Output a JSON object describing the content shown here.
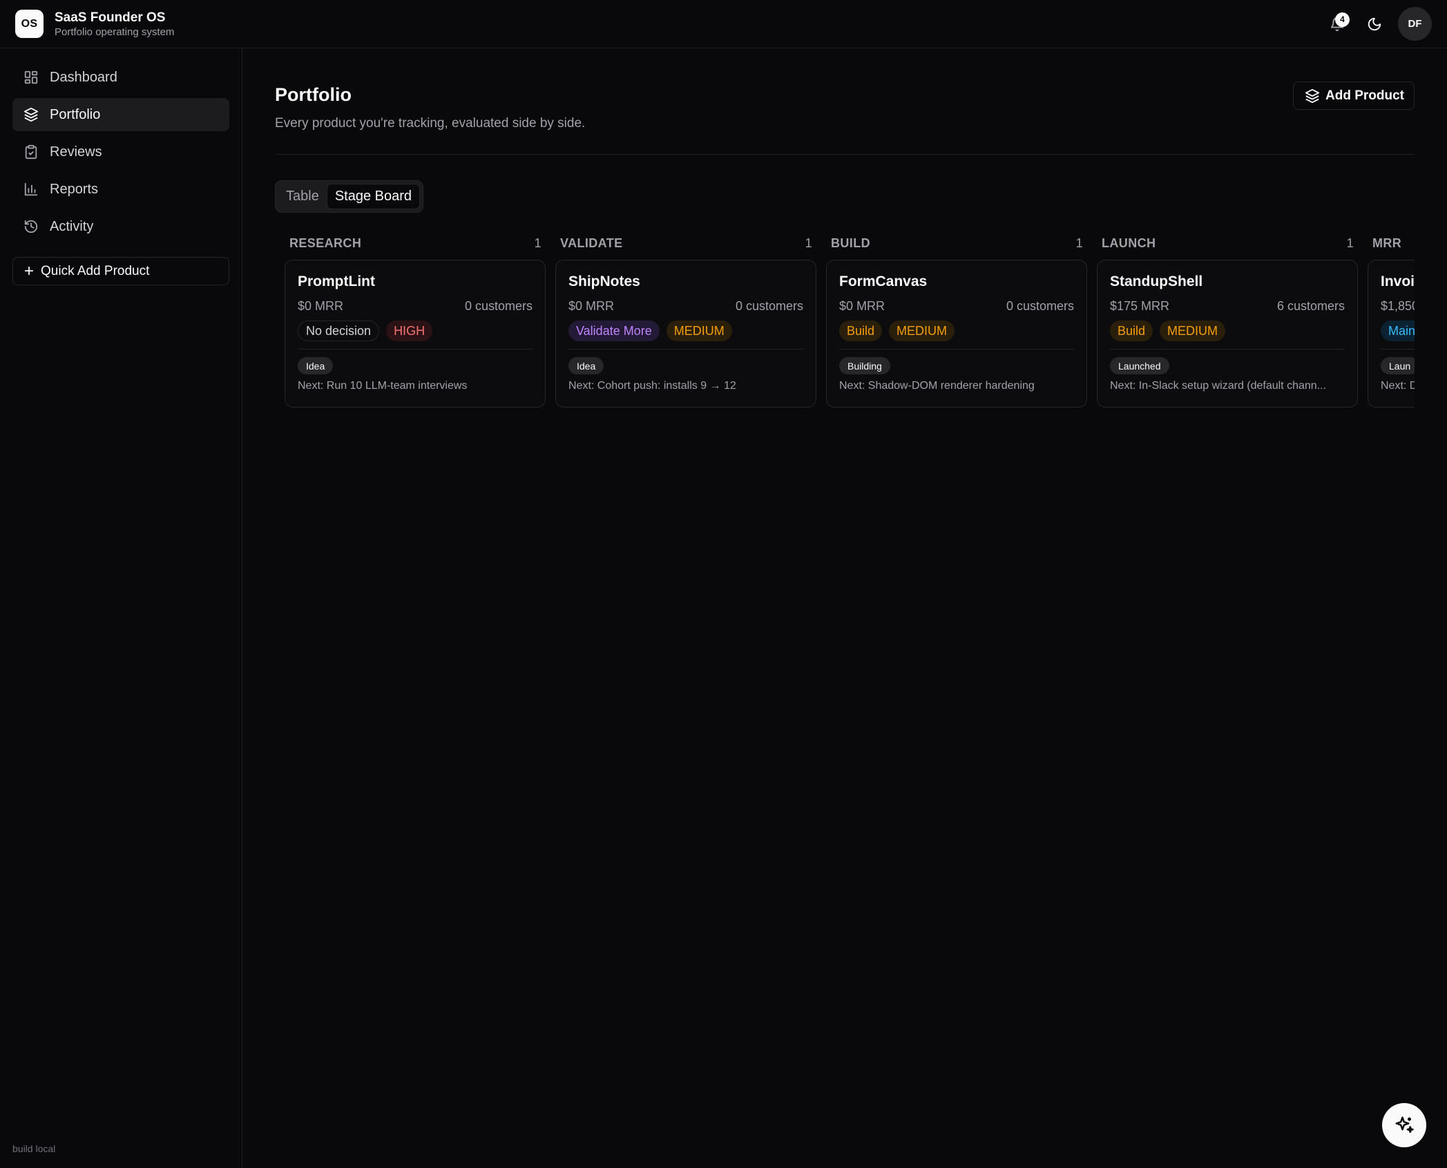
{
  "app": {
    "title": "SaaS Founder OS",
    "subtitle": "Portfolio operating system",
    "logo_text": "OS"
  },
  "header": {
    "notifications_count": "4",
    "avatar_initials": "DF",
    "icons": [
      "bell-icon",
      "moon-icon"
    ]
  },
  "sidebar": {
    "items": [
      {
        "label": "Dashboard",
        "icon": "dashboard-icon",
        "active": false
      },
      {
        "label": "Portfolio",
        "icon": "layers-icon",
        "active": true
      },
      {
        "label": "Reviews",
        "icon": "clipboard-check-icon",
        "active": false
      },
      {
        "label": "Reports",
        "icon": "bar-chart-icon",
        "active": false
      },
      {
        "label": "Activity",
        "icon": "history-icon",
        "active": false
      }
    ],
    "quick_add_label": "Quick Add Product",
    "build_label": "build local"
  },
  "page": {
    "title": "Portfolio",
    "subtitle": "Every product you're tracking, evaluated side by side.",
    "add_button_label": "Add Product",
    "view_toggle": {
      "options": [
        "Table",
        "Stage Board"
      ],
      "selected": "Stage Board"
    }
  },
  "board": {
    "columns": [
      {
        "name": "RESEARCH",
        "count": "1",
        "card": {
          "title": "PromptLint",
          "mrr": "$0 MRR",
          "customers": "0 customers",
          "decision": "No decision",
          "priority": "HIGH",
          "stage": "Idea",
          "next": "Next: Run 10 LLM-team interviews"
        }
      },
      {
        "name": "VALIDATE",
        "count": "1",
        "card": {
          "title": "ShipNotes",
          "mrr": "$0 MRR",
          "customers": "0 customers",
          "decision": "Validate More",
          "priority": "MEDIUM",
          "stage": "Idea",
          "next": "Next: Cohort push: installs 9 → 12"
        }
      },
      {
        "name": "BUILD",
        "count": "1",
        "card": {
          "title": "FormCanvas",
          "mrr": "$0 MRR",
          "customers": "0 customers",
          "decision": "Build",
          "priority": "MEDIUM",
          "stage": "Building",
          "next": "Next: Shadow-DOM renderer hardening"
        }
      },
      {
        "name": "LAUNCH",
        "count": "1",
        "card": {
          "title": "StandupShell",
          "mrr": "$175 MRR",
          "customers": "6 customers",
          "decision": "Build",
          "priority": "MEDIUM",
          "stage": "Launched",
          "next": "Next: In-Slack setup wizard (default chann..."
        }
      },
      {
        "name": "MRR",
        "count": "",
        "card": {
          "title": "Invoi",
          "mrr": "$1,850",
          "customers": "",
          "decision": "Main",
          "priority": "",
          "stage": "Laun",
          "next": "Next: D"
        }
      }
    ]
  },
  "colors": {
    "background": "#09090b",
    "high": "#f87171",
    "medium": "#f59e0b",
    "validate": "#c084fc",
    "maintain": "#38bdf8"
  }
}
